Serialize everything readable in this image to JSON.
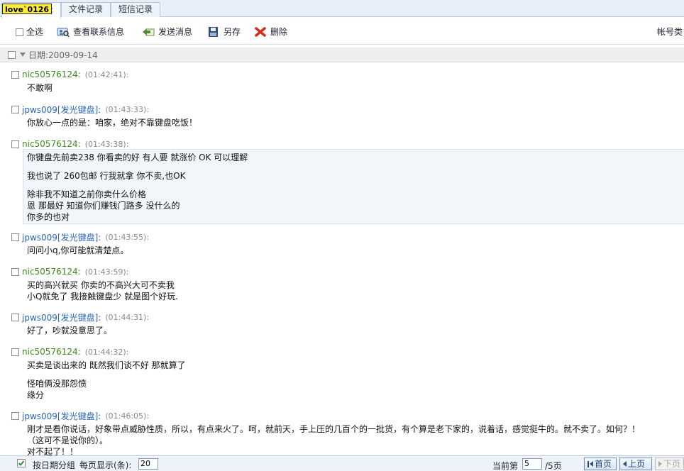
{
  "window": {
    "title_badge": "love`0126"
  },
  "tabs": [
    {
      "label": "录",
      "active": true
    },
    {
      "label": "文件记录",
      "active": false
    },
    {
      "label": "短信记录",
      "active": false
    }
  ],
  "toolbar": {
    "select_all": "全选",
    "view_contact": "查看联系信息",
    "send_message": "发送消息",
    "save_as": "另存",
    "delete": "删除",
    "account_type": "帐号类"
  },
  "date_group": {
    "label": "日期:2009-09-14"
  },
  "messages": [
    {
      "sender": "nic50576124:",
      "time": "(01:42:41):",
      "lines": [
        "不敢啊"
      ]
    },
    {
      "sender": "jpws009[发光键盘]:",
      "time": "(01:43:33):",
      "lines": [
        "你放心一点的是：咱家，绝对不靠键盘吃饭！"
      ]
    },
    {
      "sender": "nic50576124:",
      "time": "(01:43:38):",
      "lines": [
        "你键盘先前卖238  你看卖的好 有人要 就涨价 OK 可以理解",
        "",
        "我也说了 260包邮 行我就拿 你不卖,也OK",
        "",
        "除非我不知道之前你卖什么价格",
        "恩 那最好 知道你们赚钱门路多 没什么的",
        "你多的也对"
      ]
    },
    {
      "sender": "jpws009[发光键盘]:",
      "time": "(01:43:55):",
      "lines": [
        "问问小q,你可能就清楚点。"
      ]
    },
    {
      "sender": "nic50576124:",
      "time": "(01:43:59):",
      "lines": [
        "买的高兴就买 你卖的不高兴大可不卖我",
        "小Q就免了 我接触键盘少 就是图个好玩."
      ]
    },
    {
      "sender": "jpws009[发光键盘]:",
      "time": "(01:44:31):",
      "lines": [
        "好了，吵就没意思了。"
      ]
    },
    {
      "sender": "nic50576124:",
      "time": "(01:44:32):",
      "lines": [
        "买卖是谈出来的 既然我们谈不好 那就算了",
        "",
        "怪咱俩没那怨愤",
        "缘分"
      ]
    },
    {
      "sender": "jpws009[发光键盘]:",
      "time": "(01:46:05):",
      "lines": [
        "刚才是看你说话，好象带点威胁性质，所以，有点来火了。呵，就前天，手上压的几百个的一批货，有个算是老下家的，说着话，感觉挺牛的。就不卖了。如何？！",
        "（这可不是说你的）。",
        "对不起了！！"
      ]
    }
  ],
  "footer": {
    "group_by_date": "按日期分组",
    "per_page_label": "每页显示(条):",
    "per_page_value": "20",
    "current_page_label": "当前第",
    "current_page_value": "5",
    "total_pages": "/5页",
    "first_page": "首页",
    "prev_page": "上页",
    "next_page": "下页"
  },
  "colors": {
    "sender_self": "#3c8a1e",
    "sender_other": "#2a66b4",
    "accent": "#b7c8df"
  }
}
